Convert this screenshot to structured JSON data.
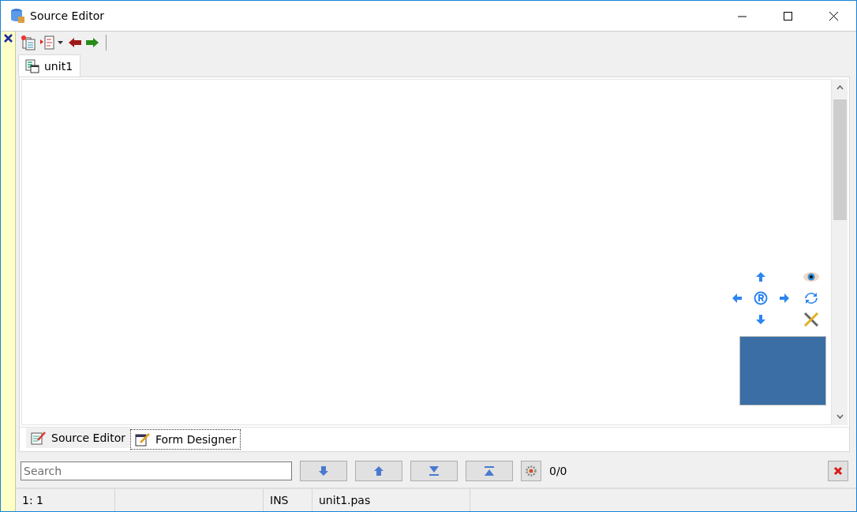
{
  "window": {
    "title": "Source Editor"
  },
  "tabs": [
    {
      "label": "unit1",
      "selected": true
    }
  ],
  "view_tabs": [
    {
      "label": "Source Editor",
      "selected": false,
      "kind": "source"
    },
    {
      "label": "Form Designer",
      "selected": true,
      "kind": "form"
    }
  ],
  "search": {
    "placeholder": "Search",
    "match_count": "0/0"
  },
  "status_bar": {
    "position": "1:  1",
    "mode": "INS",
    "file": "unit1.pas"
  }
}
